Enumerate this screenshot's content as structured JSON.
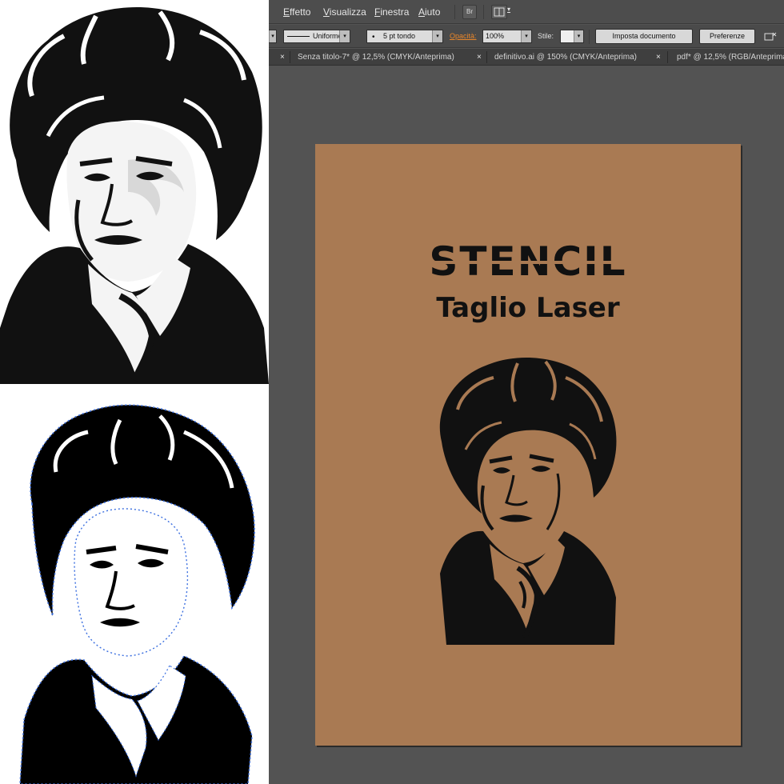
{
  "menu": {
    "items": [
      "Effetto",
      "Visualizza",
      "Finestra",
      "Aiuto"
    ],
    "bridge_icon": "Br",
    "arrange_icon": "arrange-documents-icon"
  },
  "control_bar": {
    "stroke_profile": "Uniforme",
    "brush": "5 pt tondo",
    "opacity_label": "Opacità:",
    "opacity_value": "100%",
    "style_label": "Stile:",
    "doc_setup_button": "Imposta documento",
    "preferences_button": "Preferenze"
  },
  "tabs": [
    {
      "label": "Senza titolo-7* @ 12,5% (CMYK/Anteprima)"
    },
    {
      "label": "definitivo.ai @ 150% (CMYK/Anteprima)"
    },
    {
      "label": "pdf* @ 12,5% (RGB/Anteprima"
    }
  ],
  "artboard": {
    "title": "STENCIL",
    "subtitle": "Taglio Laser",
    "background_color": "#a97a53"
  },
  "colors": {
    "accent_opacity_label": "#e8862a",
    "path_anchor_blue": "#3b6fe0"
  }
}
